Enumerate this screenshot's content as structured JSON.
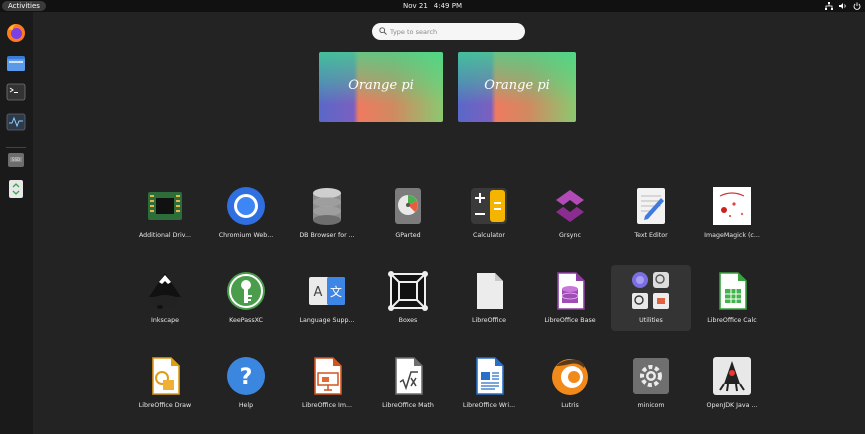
{
  "topbar": {
    "activities": "Activities",
    "date": "Nov 21",
    "time": "4:49 PM",
    "icons": [
      "network-icon",
      "volume-icon",
      "power-icon"
    ]
  },
  "dock": [
    "firefox-icon",
    "files-icon",
    "terminal-icon",
    "system-monitor-icon",
    "ssd-drive-icon",
    "trash-icon"
  ],
  "search": {
    "placeholder": "Type to search"
  },
  "workspaces": [
    {
      "label": "Orange pi"
    },
    {
      "label": "Orange pi"
    }
  ],
  "apps": [
    {
      "label": "Additional Driv...",
      "icon": "chip-icon"
    },
    {
      "label": "Chromium Web...",
      "icon": "chromium-icon"
    },
    {
      "label": "DB Browser for ...",
      "icon": "database-icon"
    },
    {
      "label": "GParted",
      "icon": "gparted-icon"
    },
    {
      "label": "Calculator",
      "icon": "calculator-icon"
    },
    {
      "label": "Grsync",
      "icon": "grsync-icon"
    },
    {
      "label": "Text Editor",
      "icon": "text-editor-icon"
    },
    {
      "label": "ImageMagick (c...",
      "icon": "imagemagick-icon"
    },
    {
      "label": "Inkscape",
      "icon": "inkscape-icon"
    },
    {
      "label": "KeePassXC",
      "icon": "keepassxc-icon"
    },
    {
      "label": "Language Supp...",
      "icon": "language-support-icon"
    },
    {
      "label": "Boxes",
      "icon": "boxes-icon"
    },
    {
      "label": "LibreOffice",
      "icon": "libreoffice-icon"
    },
    {
      "label": "LibreOffice Base",
      "icon": "libreoffice-base-icon"
    },
    {
      "label": "Utilities",
      "icon": "utilities-folder-icon"
    },
    {
      "label": "LibreOffice Calc",
      "icon": "libreoffice-calc-icon"
    },
    {
      "label": "LibreOffice Draw",
      "icon": "libreoffice-draw-icon"
    },
    {
      "label": "Help",
      "icon": "help-icon"
    },
    {
      "label": "LibreOffice Im...",
      "icon": "libreoffice-impress-icon"
    },
    {
      "label": "LibreOffice Math",
      "icon": "libreoffice-math-icon"
    },
    {
      "label": "LibreOffice Wri...",
      "icon": "libreoffice-writer-icon"
    },
    {
      "label": "Lutris",
      "icon": "lutris-icon"
    },
    {
      "label": "minicom",
      "icon": "minicom-icon"
    },
    {
      "label": "OpenJDK Java ...",
      "icon": "java-icon"
    }
  ]
}
